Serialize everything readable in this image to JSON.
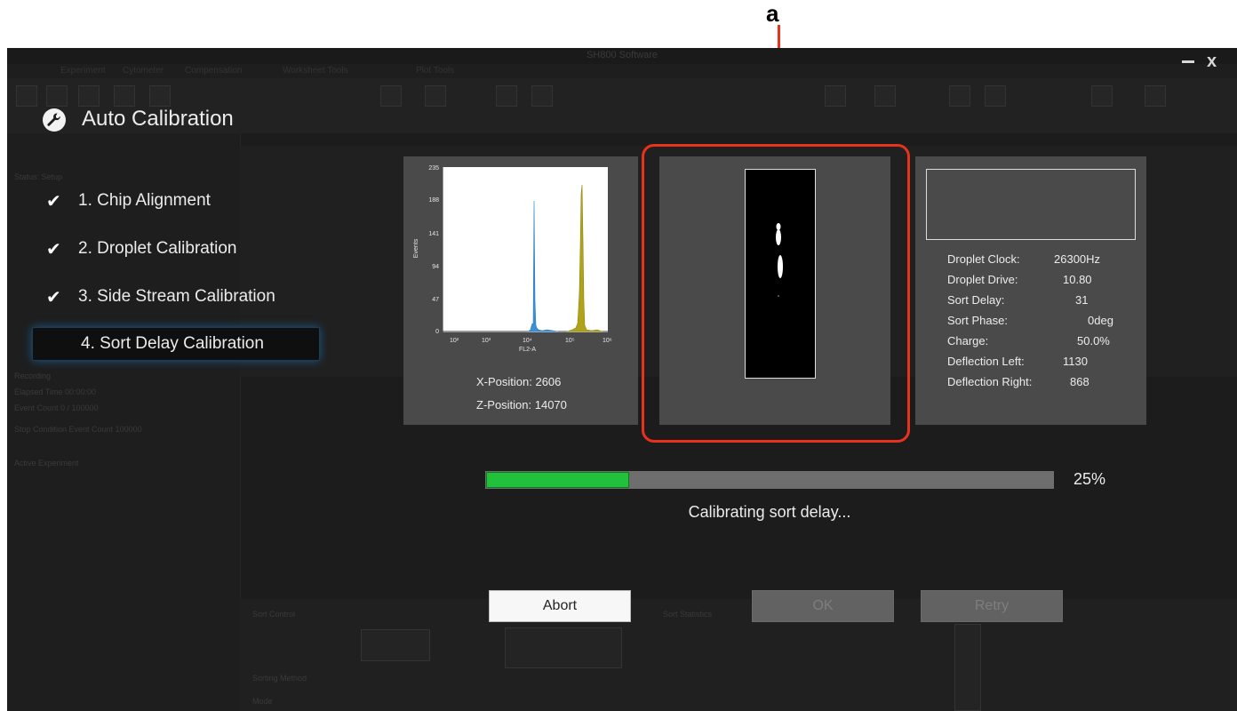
{
  "annotation": {
    "label": "a"
  },
  "window": {
    "title": "SH800 Software",
    "tabs": [
      "Experiment",
      "Cytometer",
      "Compensation",
      "Worksheet Tools",
      "Plot Tools"
    ],
    "close_glyph": "x",
    "icons": {
      "minimize": "minimize-icon",
      "close": "close-icon"
    }
  },
  "background": {
    "status_label": "Status: Setup",
    "recording_label": "Recording",
    "elapsed_time": "Elapsed Time   00:00:00",
    "event_count": "Event Count        0 / 100000",
    "stop_condition": "Stop Condition   Event Count   100000",
    "active_experiment": "Active Experiment",
    "sort_control": "Sort Control",
    "sort_statistics": "Sort Statistics",
    "sorting_method": "Sorting Method",
    "mode": "Mode"
  },
  "dialog": {
    "title": "Auto Calibration",
    "title_icon": "wrench-icon",
    "steps": [
      {
        "label": "1. Chip Alignment",
        "done": true
      },
      {
        "label": "2. Droplet Calibration",
        "done": true
      },
      {
        "label": "3. Side Stream Calibration",
        "done": true
      },
      {
        "label": "4. Sort Delay Calibration",
        "done": false,
        "active": true
      }
    ],
    "check_glyph": "✔",
    "histogram": {
      "y_ticks": [
        "235",
        "188",
        "141",
        "94",
        "47",
        "0"
      ],
      "x_ticks": [
        "10²",
        "10³",
        "10⁴",
        "10⁵",
        "10⁶"
      ],
      "xlabel": "FL2-A",
      "ylabel": "Events",
      "x_position": "X-Position:  2606",
      "z_position": "Z-Position:  14070"
    },
    "parameters": [
      {
        "label": "Droplet Clock:",
        "value": "26300Hz"
      },
      {
        "label": "Droplet Drive:",
        "value": "10.80"
      },
      {
        "label": "Sort Delay:",
        "value": "31"
      },
      {
        "label": "Sort Phase:",
        "value": "0deg"
      },
      {
        "label": "Charge:",
        "value": "50.0%"
      },
      {
        "label": "Deflection Left:",
        "value": "1130"
      },
      {
        "label": "Deflection Right:",
        "value": "868"
      }
    ],
    "progress": {
      "fraction": 0.25,
      "label": "25%"
    },
    "status_text": "Calibrating sort delay...",
    "buttons": {
      "abort": "Abort",
      "ok": "OK",
      "retry": "Retry"
    }
  }
}
